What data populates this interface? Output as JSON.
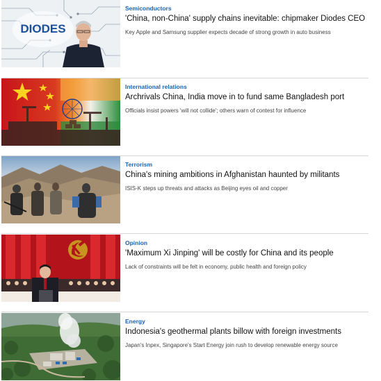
{
  "articles": [
    {
      "category": "Semiconductors",
      "headline": "'China, non-China' supply chains inevitable: chipmaker Diodes CEO",
      "summary": "Key Apple and Samsung supplier expects decade of strong growth in auto business",
      "image_text": "DIODES"
    },
    {
      "category": "International relations",
      "headline": "Archrivals China, India move in to fund same Bangladesh port",
      "summary": "Officials insist powers 'will not collide'; others warn of contest for influence"
    },
    {
      "category": "Terrorism",
      "headline": "China's mining ambitions in Afghanistan haunted by militants",
      "summary": "ISIS-K steps up threats and attacks as Beijing eyes oil and copper"
    },
    {
      "category": "Opinion",
      "headline": "'Maximum Xi Jinping' will be costly for China and its people",
      "summary": "Lack of constraints will be felt in economy, public health and foreign policy"
    },
    {
      "category": "Energy",
      "headline": "Indonesia's geothermal plants billow with foreign investments",
      "summary": "Japan's Inpex, Singapore's Start Energy join rush to develop renewable energy source"
    }
  ]
}
